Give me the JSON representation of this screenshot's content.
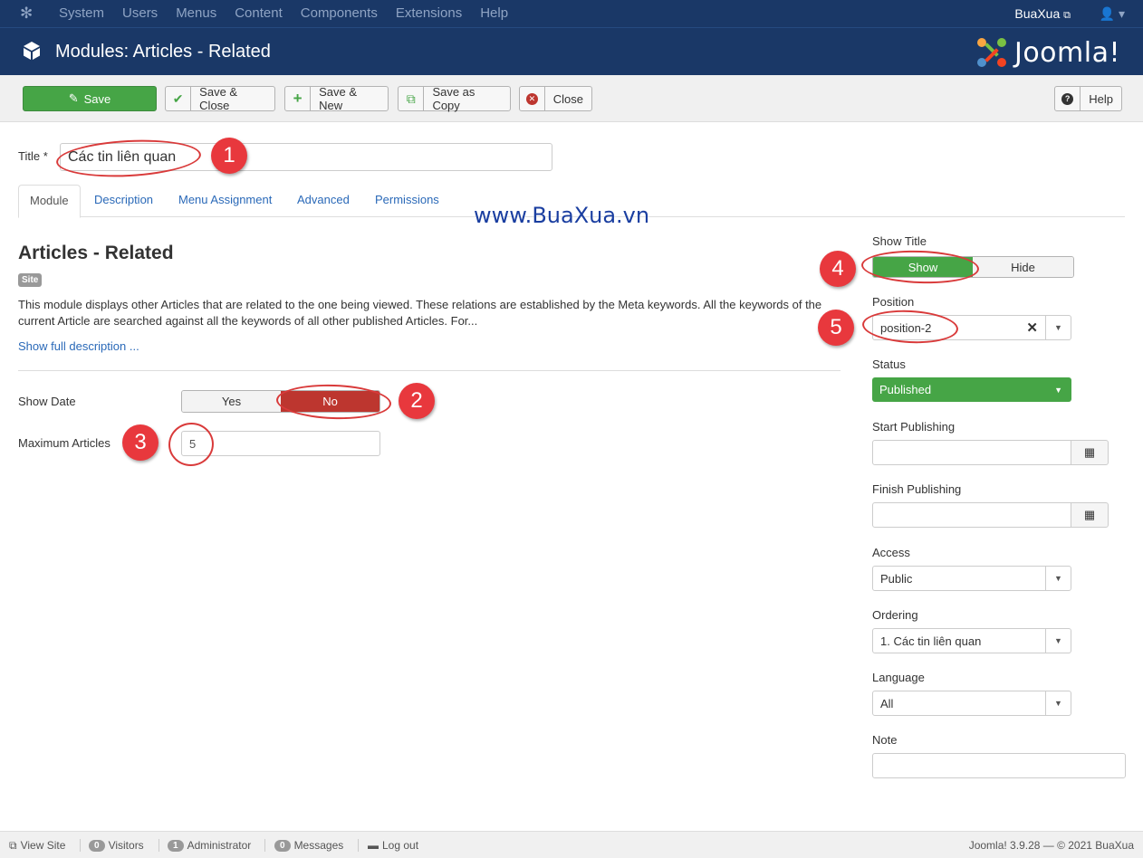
{
  "topnav": {
    "items": [
      "System",
      "Users",
      "Menus",
      "Content",
      "Components",
      "Extensions",
      "Help"
    ],
    "site_name": "BuaXua"
  },
  "header": {
    "title": "Modules: Articles - Related",
    "brand": "Joomla!"
  },
  "toolbar": {
    "save": "Save",
    "save_close": "Save & Close",
    "save_new": "Save & New",
    "save_copy": "Save as Copy",
    "close": "Close",
    "help": "Help"
  },
  "form": {
    "title_label": "Title *",
    "title_value": "Các tin liên quan"
  },
  "tabs": [
    "Module",
    "Description",
    "Menu Assignment",
    "Advanced",
    "Permissions"
  ],
  "watermark": "www.BuaXua.vn",
  "module": {
    "name": "Articles - Related",
    "badge": "Site",
    "description": "This module displays other Articles that are related to the one being viewed. These relations are established by the Meta keywords. All the keywords of the current Article are searched against all the keywords of all other published Articles. For...",
    "show_full": "Show full description ..."
  },
  "options": {
    "show_date_label": "Show Date",
    "yes": "Yes",
    "no": "No",
    "max_articles_label": "Maximum Articles",
    "max_articles_value": "5"
  },
  "sidebar": {
    "show_title_label": "Show Title",
    "show": "Show",
    "hide": "Hide",
    "position_label": "Position",
    "position_value": "position-2",
    "status_label": "Status",
    "status_value": "Published",
    "start_label": "Start Publishing",
    "finish_label": "Finish Publishing",
    "access_label": "Access",
    "access_value": "Public",
    "ordering_label": "Ordering",
    "ordering_value": "1. Các tin liên quan",
    "language_label": "Language",
    "language_value": "All",
    "note_label": "Note"
  },
  "annotations": [
    "1",
    "2",
    "3",
    "4",
    "5"
  ],
  "footer": {
    "view_site": "View Site",
    "visitors_count": "0",
    "visitors": "Visitors",
    "admin_count": "1",
    "admin": "Administrator",
    "messages_count": "0",
    "messages": "Messages",
    "logout": "Log out",
    "version": "Joomla! 3.9.28  —  © 2021 BuaXua"
  },
  "colors": {
    "navbar": "#1a3867",
    "save_green": "#46a546",
    "no_red": "#bd362f",
    "link_blue": "#2a69b8",
    "annotation_red": "#e8383d"
  }
}
